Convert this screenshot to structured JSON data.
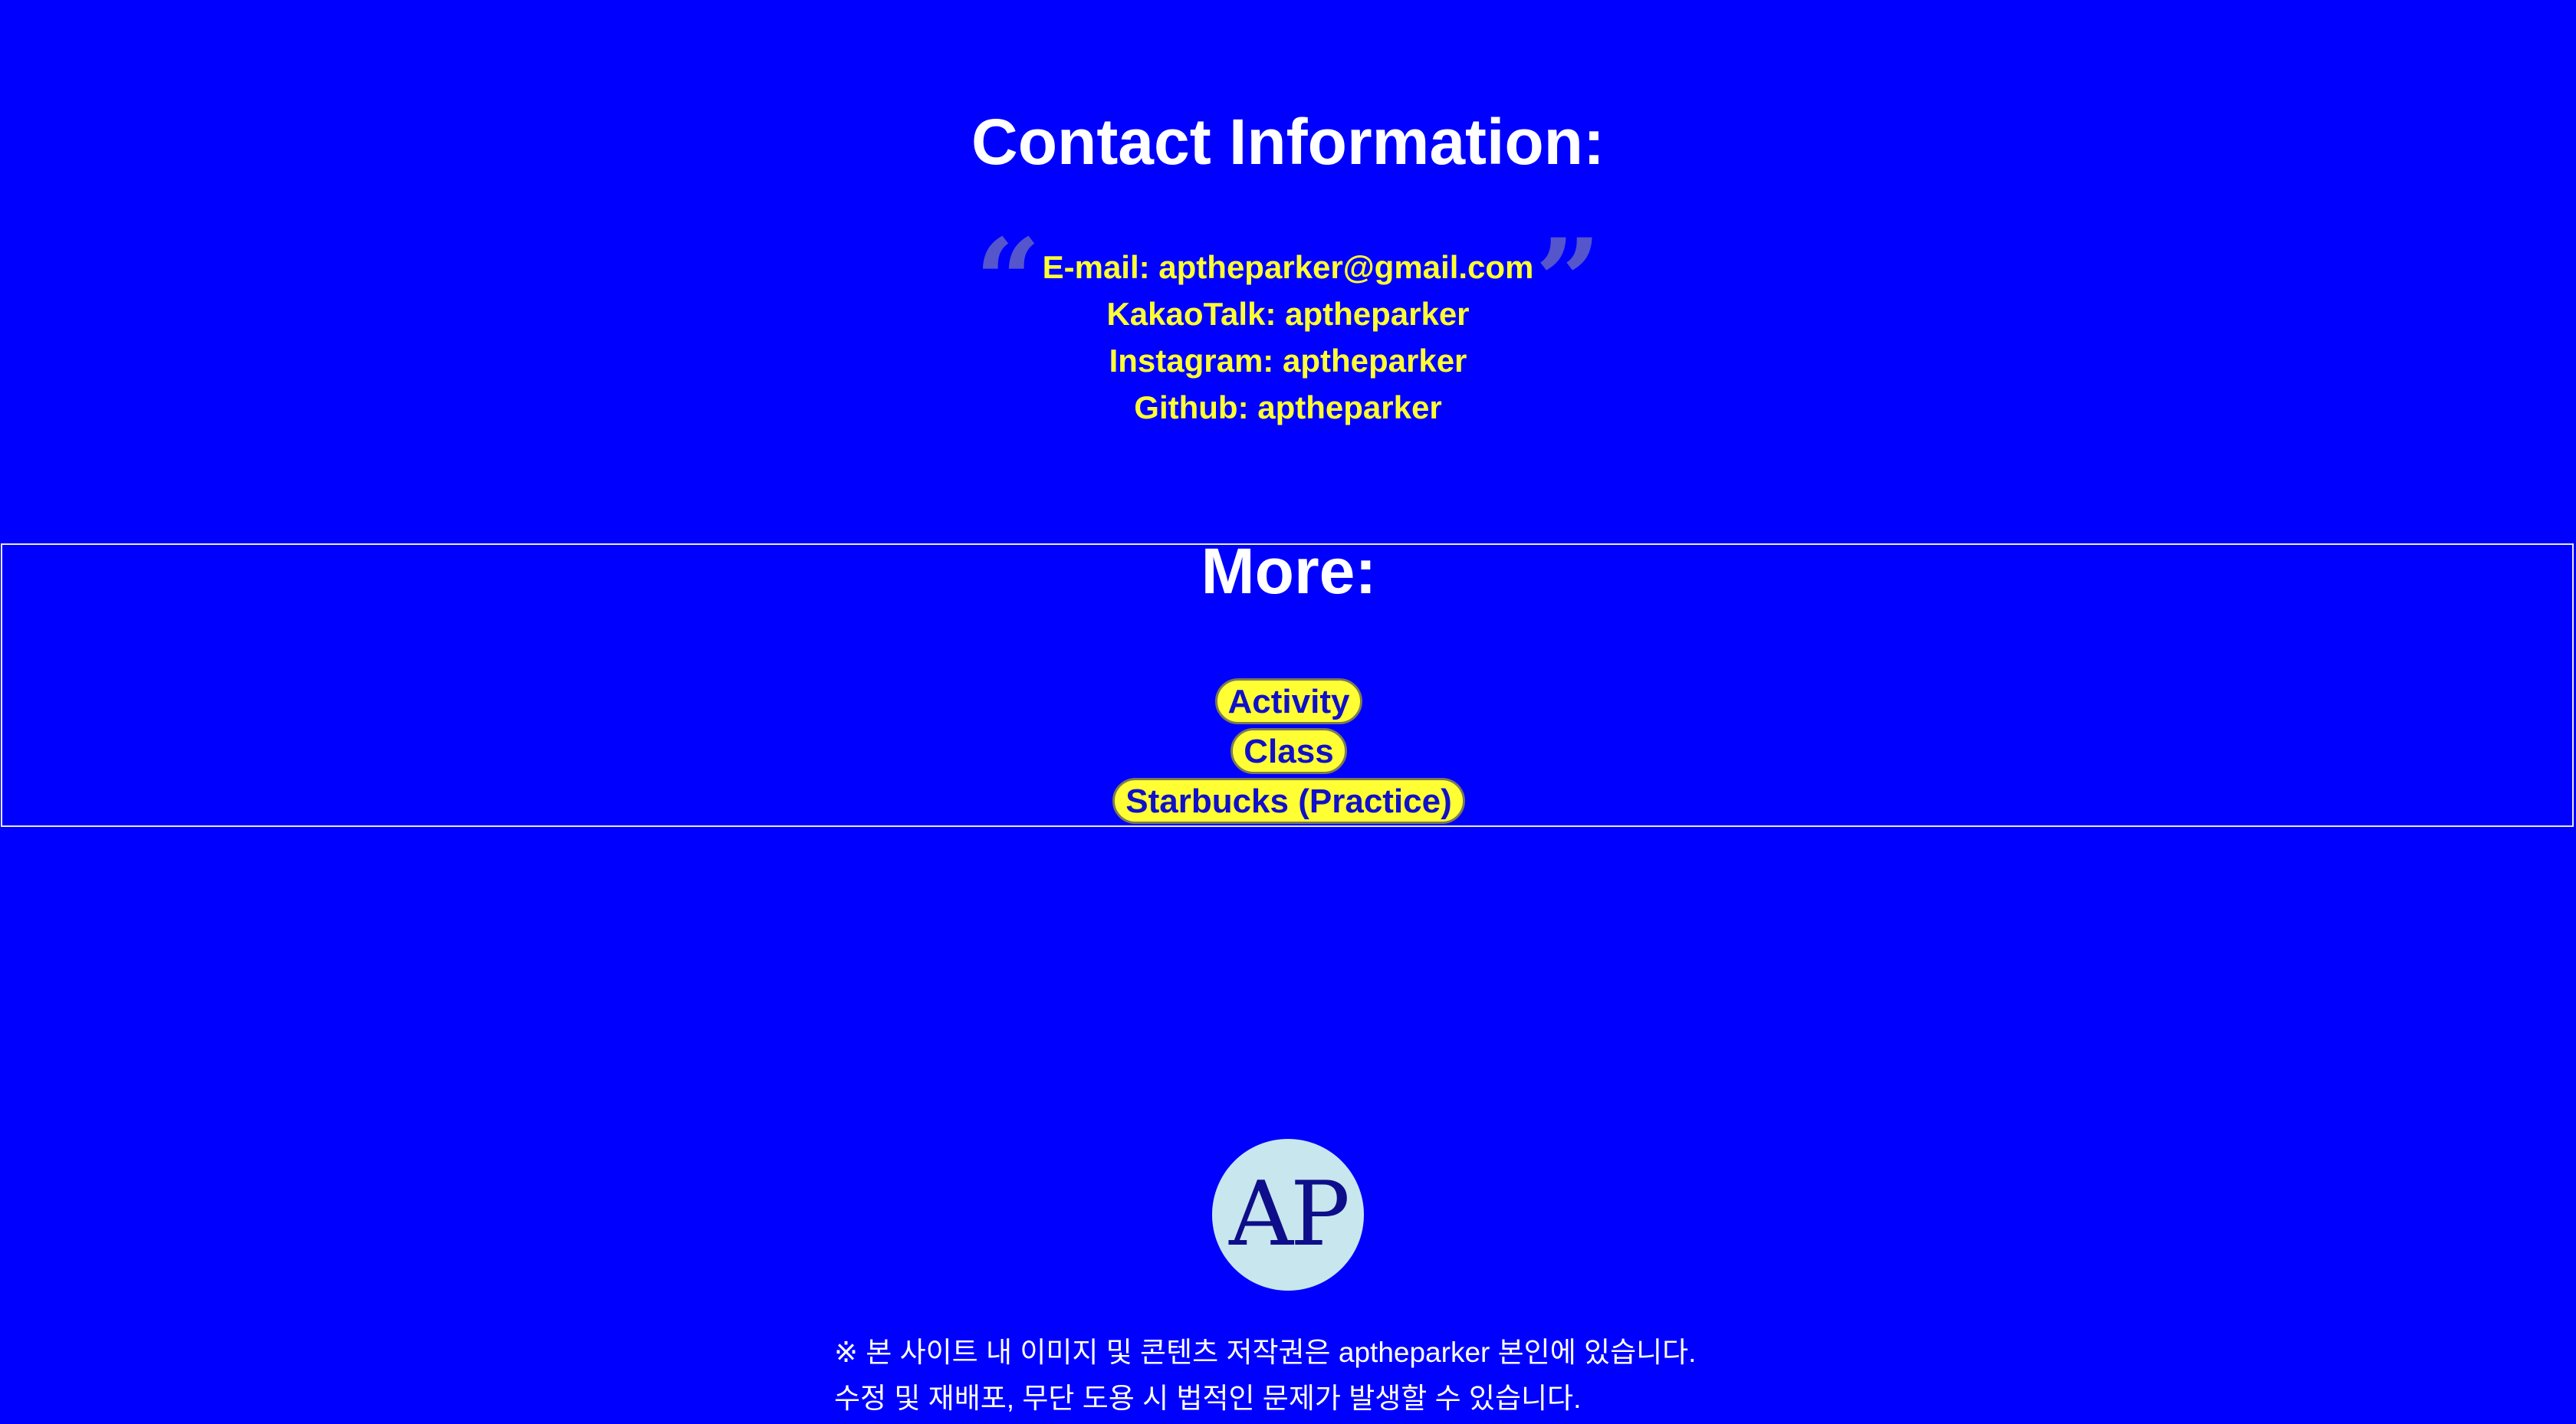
{
  "contact": {
    "title": "Contact Information:",
    "lines": [
      "E-mail: aptheparker@gmail.com",
      "KakaoTalk: aptheparker",
      "Instagram: aptheparker",
      "Github: aptheparker"
    ],
    "quote_open": "“",
    "quote_close": "”"
  },
  "more": {
    "title": "More:",
    "links": [
      "Activity",
      "Class",
      "Starbucks (Practice)"
    ]
  },
  "logo": {
    "text": "AP"
  },
  "footer": {
    "lines": [
      "※ 본 사이트 내 이미지 및 콘텐츠 저작권은 aptheparker 본인에 있습니다.",
      "수정 및 재배포, 무단 도용 시 법적인 문제가 발생할 수 있습니다."
    ]
  },
  "colors": {
    "background": "#0000ff",
    "accent": "#ffff33",
    "heading": "#ffffff",
    "link_text": "#1010c8",
    "logo_bg": "#c8e6ee"
  }
}
